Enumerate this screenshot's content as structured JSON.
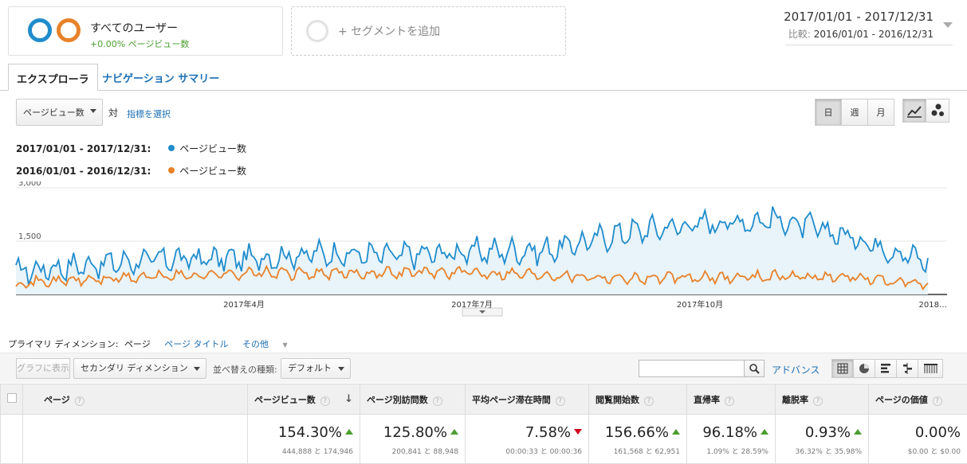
{
  "segments": {
    "primary": {
      "title": "すべてのユーザー",
      "subtitle": "+0.00% ページビュー数"
    },
    "add": {
      "label": "+ セグメントを追加"
    }
  },
  "date_range": {
    "main": "2017/01/01 - 2017/12/31",
    "compare_label": "比較:",
    "compare_value": "2016/01/01 - 2016/12/31"
  },
  "tabs": [
    {
      "label": "エクスプローラ",
      "active": true
    },
    {
      "label": "ナビゲーション サマリー",
      "active": false
    }
  ],
  "chart_controls": {
    "metric_select": "ページビュー数",
    "vs_label": "対",
    "select_metric_link": "指標を選択",
    "granularity": [
      "日",
      "週",
      "月"
    ],
    "granularity_active": "日"
  },
  "legend": [
    {
      "range": "2017/01/01 - 2017/12/31:",
      "name": "ページビュー数",
      "color": "#1f8ccc"
    },
    {
      "range": "2016/01/01 - 2016/12/31:",
      "name": "ページビュー数",
      "color": "#e8822a"
    }
  ],
  "chart_data": {
    "type": "line",
    "ylim": [
      0,
      3000
    ],
    "y_ticks": [
      "3,000",
      "1,500"
    ],
    "x_tick_labels": [
      "2017年4月",
      "2017年7月",
      "2017年10月",
      "2018…"
    ],
    "series": [
      {
        "name": "2017/01/01 - 2017/12/31: ページビュー数",
        "color": "#1f8ccc",
        "fill": true,
        "monthly_values": [
          650,
          850,
          1000,
          1000,
          1150,
          1100,
          1200,
          1250,
          1750,
          2000,
          2100,
          1600,
          900
        ]
      },
      {
        "name": "2016/01/01 - 2016/12/31: ページビュー数",
        "color": "#e8822a",
        "fill": false,
        "monthly_values": [
          320,
          420,
          520,
          600,
          580,
          620,
          620,
          560,
          460,
          460,
          520,
          480,
          250
        ]
      }
    ]
  },
  "dimension_bar": {
    "label": "プライマリ ディメンション:",
    "current": "ページ",
    "options": [
      "ページ タイトル"
    ],
    "other": "その他"
  },
  "table_toolbar": {
    "graph_btn": "グラフに表示",
    "secondary_dim": "セカンダリ ディメンション",
    "sort_label": "並べ替えの種類:",
    "sort_value": "デフォルト",
    "advanced": "アドバンス"
  },
  "table": {
    "columns": [
      "ページ",
      "ページビュー数",
      "ページ別訪問数",
      "平均ページ滞在時間",
      "閲覧開始数",
      "直帰率",
      "離脱率",
      "ページの価値"
    ],
    "totals": [
      {
        "value": "154.30%",
        "trend": "up",
        "detail": "444,888 と 174,946"
      },
      {
        "value": "125.80%",
        "trend": "up",
        "detail": "200,841 と 88,948"
      },
      {
        "value": "7.58%",
        "trend": "down",
        "detail": "00:00:33 と 00:00:36"
      },
      {
        "value": "156.66%",
        "trend": "up",
        "detail": "161,568 と 62,951"
      },
      {
        "value": "96.18%",
        "trend": "up",
        "detail": "1.09% と 28.59%"
      },
      {
        "value": "0.93%",
        "trend": "up",
        "detail": "36.32% と 35.98%"
      },
      {
        "value": "0.00%",
        "trend": "none",
        "detail": "$0.00 と $0.00"
      }
    ]
  }
}
